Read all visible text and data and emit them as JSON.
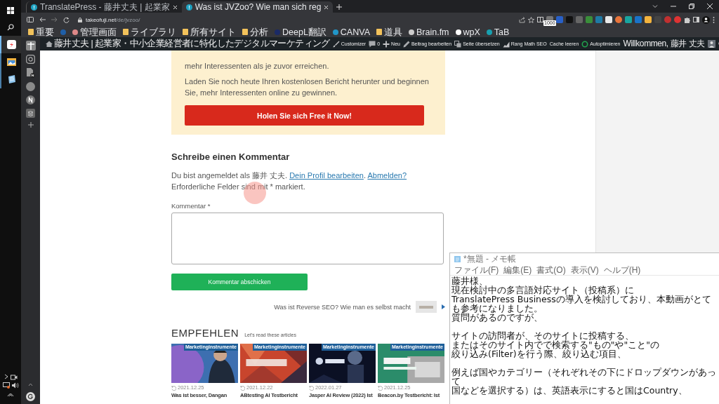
{
  "taskbar": {
    "apps": [
      {
        "selected": true
      },
      {
        "selected": false
      },
      {
        "selected": false
      }
    ]
  },
  "tabs": [
    {
      "title": "TranslatePress - 藤井丈夫 | 起業家",
      "selected": false
    },
    {
      "title": "Was ist JVZoo? Wie man sich reg",
      "selected": true
    }
  ],
  "address": {
    "host": "takeofuji.net",
    "path": "/de/jvzoo/"
  },
  "extension_badge": "1000",
  "bookmarks": [
    {
      "kind": "folder",
      "label": "重要"
    },
    {
      "kind": "site"
    },
    {
      "kind": "site",
      "label": "管理画面"
    },
    {
      "kind": "folder",
      "label": "ライブラリ"
    },
    {
      "kind": "folder",
      "label": "所有サイト"
    },
    {
      "kind": "folder",
      "label": "分析"
    },
    {
      "kind": "site",
      "label": "DeepL翻訳"
    },
    {
      "kind": "site",
      "label": "CANVA"
    },
    {
      "kind": "folder",
      "label": "道具"
    },
    {
      "kind": "site",
      "label": "Brain.fm"
    },
    {
      "kind": "site",
      "label": "wpX"
    },
    {
      "kind": "site",
      "label": "TaB"
    }
  ],
  "admin_bar": {
    "site_title": "藤井丈夫 | 起業家・中小企業経営者に特化したデジタルマーケティング",
    "items": [
      {
        "kind": "brush",
        "label": "Customizer"
      },
      {
        "kind": "comments",
        "label": "0"
      },
      {
        "kind": "plus",
        "label": "Neu"
      },
      {
        "kind": "pencil",
        "label": "Beitrag bearbeiten"
      },
      {
        "kind": "translate",
        "label": "Seite übersetzen"
      },
      {
        "kind": "chart",
        "label": "Rang Math SEO"
      },
      {
        "kind": "text",
        "label": "Cache leeren"
      },
      {
        "kind": "ring",
        "label": "Autoptimieren"
      }
    ],
    "greeting": "Willkommen, 藤井 丈夫"
  },
  "cta_box": {
    "paragraphs": [
      "mehr Interessenten als je zuvor erreichen.",
      "Laden Sie noch heute Ihren kostenlosen Bericht herunter und beginnen Sie, mehr Interessenten online zu gewinnen."
    ],
    "button": "Holen Sie sich Free it Now!"
  },
  "comment_form": {
    "heading": "Schreibe einen Kommentar",
    "notice": [
      {
        "kind": "text",
        "text": "Du bist angemeldet als 藤井 丈夫. "
      },
      {
        "kind": "link",
        "text": "Dein Profil bearbeiten"
      },
      {
        "kind": "text",
        "text": ". "
      },
      {
        "kind": "link",
        "text": "Abmelden?"
      },
      {
        "kind": "text",
        "text": " Erforderliche Felder sind mit * markiert."
      }
    ],
    "label": "Kommentar *",
    "submit": "Kommentar abschicken"
  },
  "next_post": "Was ist Reverse SEO? Wie man es selbst macht",
  "recommend": {
    "title": "EMPFEHLEN",
    "subtitle": "Let's read these articles",
    "cards": [
      {
        "category": "Marketinginstrumente",
        "date": "2021.12.25",
        "title": "Was ist besser, Dangan"
      },
      {
        "category": "Marketinginstrumente",
        "date": "2021.12.22",
        "title": "ABtesting AI Testbericht"
      },
      {
        "category": "Marketinginstrumente",
        "date": "2022.01.27",
        "title": "Jasper AI Review (2022) Ist"
      },
      {
        "category": "Marketinginstrumente",
        "date": "2021.12.25",
        "title": "Beacon.by Testbericht: Ist"
      }
    ]
  },
  "notepad": {
    "title": "*無題 - メモ帳",
    "menu": [
      "ファイル(F)",
      "編集(E)",
      "書式(O)",
      "表示(V)",
      "ヘルプ(H)"
    ],
    "paragraphs": [
      [
        "藤井様、",
        "現在検討中の多言語対応サイト（投稿系）に",
        "TranslatePress Businessの導入を検討しており、本動画がとても参考になりました。",
        "質問があるのですが、"
      ],
      [
        "サイトの訪問者が、そのサイトに投稿する、",
        "またはそのサイト内でで検索する\"もの\"や\"こと\"の",
        "絞り込み(Filter)を行う際、絞り込む項目、"
      ],
      [
        "例えば国やカテゴリー（それぞれその下にドロップダウンがあって",
        "国などを選択する）は、英語表示にすると国はCountry、"
      ]
    ]
  }
}
